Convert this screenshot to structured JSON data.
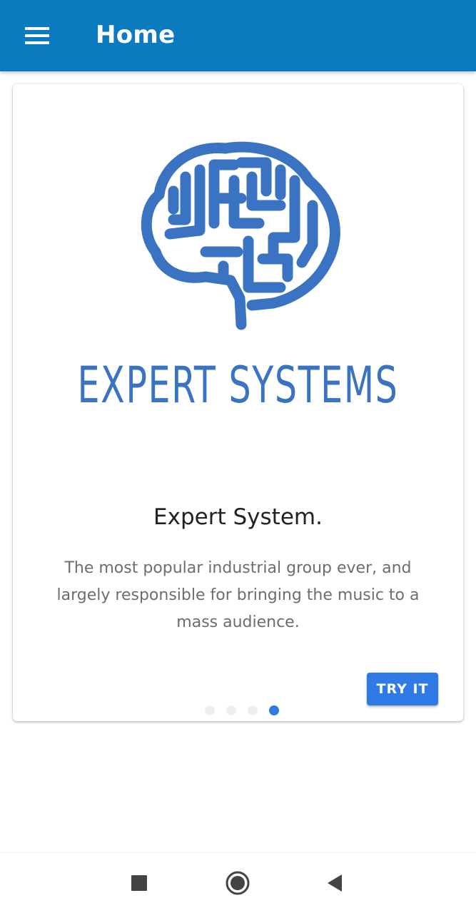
{
  "appbar": {
    "title": "Home",
    "menu_icon": "hamburger-menu-icon",
    "background_color": "#0a7bbf"
  },
  "card": {
    "logo": {
      "icon": "brain-maze-icon",
      "text": "EXPERT SYSTEMS",
      "color": "#3a73c2"
    },
    "title": "Expert System.",
    "description": "The most popular industrial group ever, and largely responsible for bringing the music to a mass audience.",
    "action_label": "TRY IT",
    "action_color": "#2f7ae5",
    "pagination": {
      "total": 4,
      "active_index": 3
    }
  },
  "navbar": {
    "items": [
      {
        "icon": "recents-square-icon"
      },
      {
        "icon": "home-circle-icon"
      },
      {
        "icon": "back-triangle-icon"
      }
    ]
  }
}
